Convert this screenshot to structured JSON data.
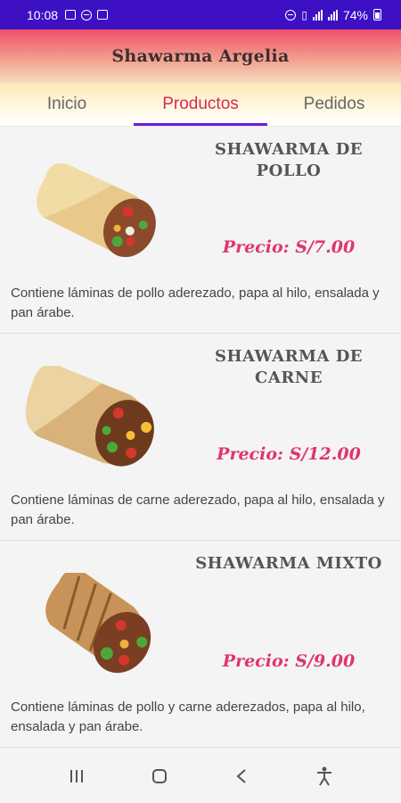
{
  "status_bar": {
    "time": "10:08",
    "battery": "74%"
  },
  "app": {
    "title": "Shawarma Argelia",
    "header_gradient": [
      "#ee5068",
      "#f7dcc0"
    ],
    "accent_color": "#d42a5a",
    "indicator_color": "#6b1fd6"
  },
  "tabs": [
    {
      "label": "Inicio",
      "active": false
    },
    {
      "label": "Productos",
      "active": true
    },
    {
      "label": "Pedidos",
      "active": false
    }
  ],
  "products": [
    {
      "name": "SHAWARMA DE POLLO",
      "price": "Precio: S/7.00",
      "description": "Contiene láminas de pollo aderezado, papa al hilo, ensalada y pan árabe.",
      "image_icon": "chicken-shawarma-wrap"
    },
    {
      "name": "SHAWARMA DE CARNE",
      "price": "Precio: S/12.00",
      "description": "Contiene láminas de carne aderezado, papa al hilo, ensalada y pan árabe.",
      "image_icon": "beef-shawarma-wrap"
    },
    {
      "name": "SHAWARMA MIXTO",
      "price": "Precio: S/9.00",
      "description": "Contiene láminas de pollo y carne aderezados, papa al hilo, ensalada y pan árabe.",
      "image_icon": "mixed-shawarma-wrap"
    }
  ],
  "nav_bar": {
    "icons": [
      "recent-apps-icon",
      "home-icon",
      "back-icon",
      "accessibility-icon"
    ]
  }
}
